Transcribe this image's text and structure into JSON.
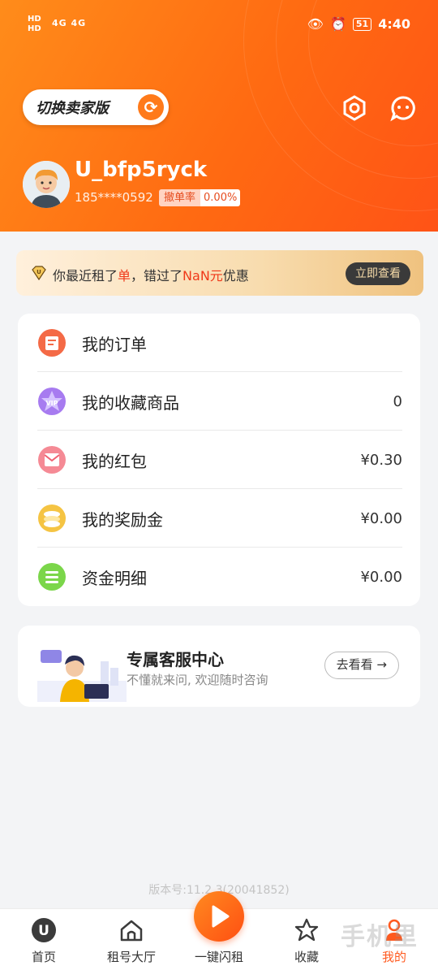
{
  "status_bar": {
    "left_top": "HD",
    "left_bottom": "HD",
    "network": "4G 4G",
    "battery": "51",
    "time": "4:40"
  },
  "header": {
    "switch_label": "切换卖家版",
    "username": "U_bfp5ryck",
    "phone": "185****0592",
    "cancel_rate_label": "撤单率",
    "cancel_rate_value": "0.00%"
  },
  "promo": {
    "text_a": "你最近租了",
    "text_b": "单",
    "text_c": "，错过了",
    "text_d": "NaN元",
    "text_e": "优惠",
    "button": "立即查看"
  },
  "menu": {
    "items": [
      {
        "label": "我的订单",
        "value": "",
        "icon": "order-icon"
      },
      {
        "label": "我的收藏商品",
        "value": "0",
        "icon": "vip-star-icon"
      },
      {
        "label": "我的红包",
        "value": "¥0.30",
        "icon": "red-envelope-icon"
      },
      {
        "label": "我的奖励金",
        "value": "¥0.00",
        "icon": "coin-stack-icon"
      },
      {
        "label": "资金明细",
        "value": "¥0.00",
        "icon": "list-icon"
      }
    ]
  },
  "service": {
    "title": "专属客服中心",
    "subtitle": "不懂就来问, 欢迎随时咨询",
    "button": "去看看 →"
  },
  "version": "版本号:11.2.3(20041852)",
  "tabs": [
    {
      "label": "首页",
      "icon": "home-u-icon"
    },
    {
      "label": "租号大厅",
      "icon": "house-icon"
    },
    {
      "label": "一键闪租",
      "icon": "play-icon"
    },
    {
      "label": "收藏",
      "icon": "star-icon"
    },
    {
      "label": "我的",
      "icon": "person-icon"
    }
  ],
  "watermark": "手机里",
  "colors": {
    "accent": "#ff6a12",
    "highlight": "#f0391a",
    "active_tab": "#ff5a1f"
  }
}
